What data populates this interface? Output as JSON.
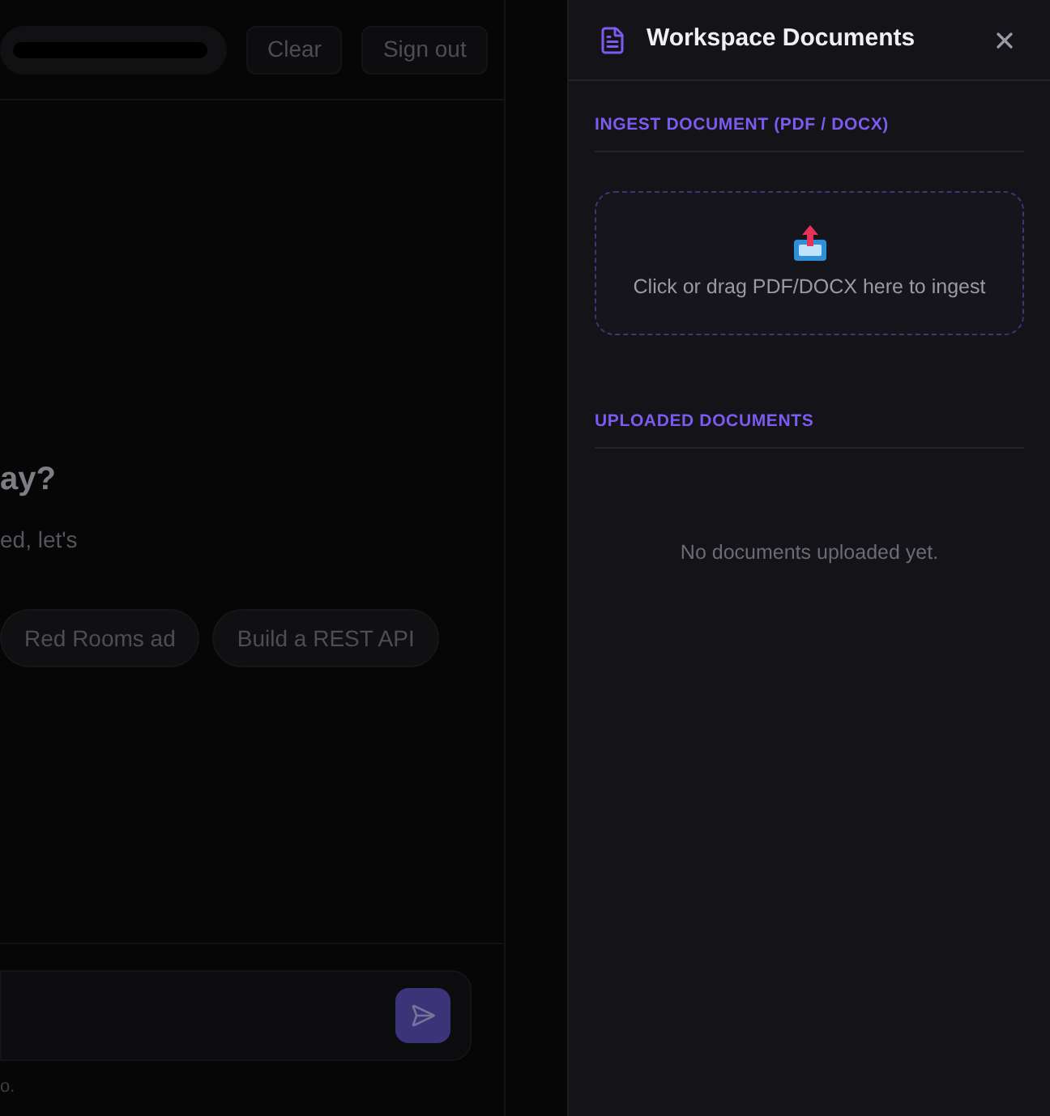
{
  "chat": {
    "header_buttons": [
      "Clear",
      "Sign out"
    ],
    "heading": "ay?",
    "subtext": "ed, let's",
    "suggestions": [
      "Red Rooms ad",
      "Build a REST API"
    ],
    "footnote": "o."
  },
  "panel": {
    "title": "Workspace Documents",
    "sections": [
      {
        "kind": "upload",
        "label": "INGEST DOCUMENT (PDF / DOCX)",
        "text": "Click or drag PDF/DOCX here to ingest"
      },
      {
        "kind": "list",
        "label": "UPLOADED DOCUMENTS",
        "text": "No documents uploaded yet."
      }
    ]
  }
}
